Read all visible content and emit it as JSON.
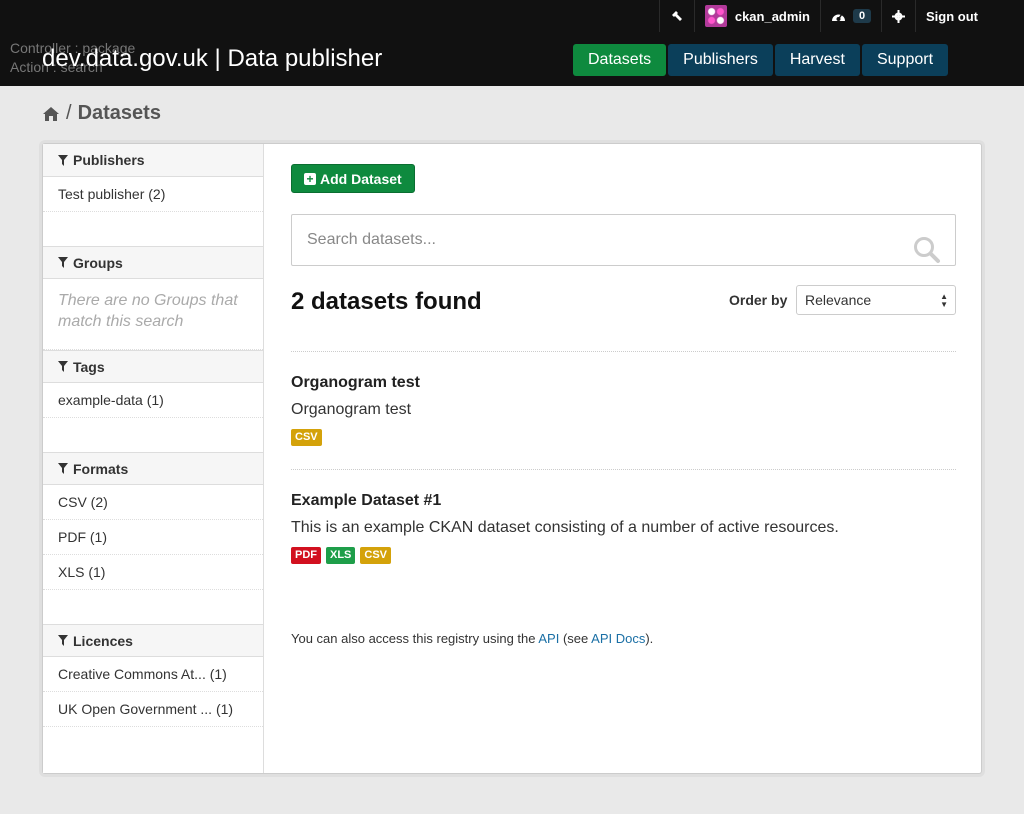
{
  "header": {
    "debug_controller": "Controller : package",
    "debug_action": "Action : search",
    "site_title": "dev.data.gov.uk | Data publisher",
    "account": {
      "username": "ckan_admin",
      "dashboard_count": "0",
      "signout": "Sign out"
    },
    "nav": [
      "Datasets",
      "Publishers",
      "Harvest",
      "Support"
    ]
  },
  "breadcrumb": {
    "current": "Datasets"
  },
  "facets": {
    "publishers": {
      "title": "Publishers",
      "items": [
        "Test publisher (2)"
      ]
    },
    "groups": {
      "title": "Groups",
      "empty": "There are no Groups that match this search"
    },
    "tags": {
      "title": "Tags",
      "items": [
        "example-data (1)"
      ]
    },
    "formats": {
      "title": "Formats",
      "items": [
        "CSV (2)",
        "PDF (1)",
        "XLS (1)"
      ]
    },
    "licences": {
      "title": "Licences",
      "items": [
        "Creative Commons At... (1)",
        "UK Open Government ... (1)"
      ]
    }
  },
  "main": {
    "add_button": "Add Dataset",
    "search_placeholder": "Search datasets...",
    "result_count": "2 datasets found",
    "order_label": "Order by",
    "order_value": "Relevance",
    "datasets": [
      {
        "title": "Organogram test",
        "description": "Organogram test",
        "formats": [
          "CSV"
        ]
      },
      {
        "title": "Example Dataset #1",
        "description": "This is an example CKAN dataset consisting of a number of active resources.",
        "formats": [
          "PDF",
          "XLS",
          "CSV"
        ]
      }
    ],
    "api_note": {
      "before": "You can also access this registry using the ",
      "api_link": "API",
      "middle": " (see ",
      "docs_link": "API Docs",
      "after": ")."
    }
  },
  "colors": {
    "CSV": "#d4a20a",
    "PDF": "#d2101f",
    "XLS": "#1e9e49"
  }
}
